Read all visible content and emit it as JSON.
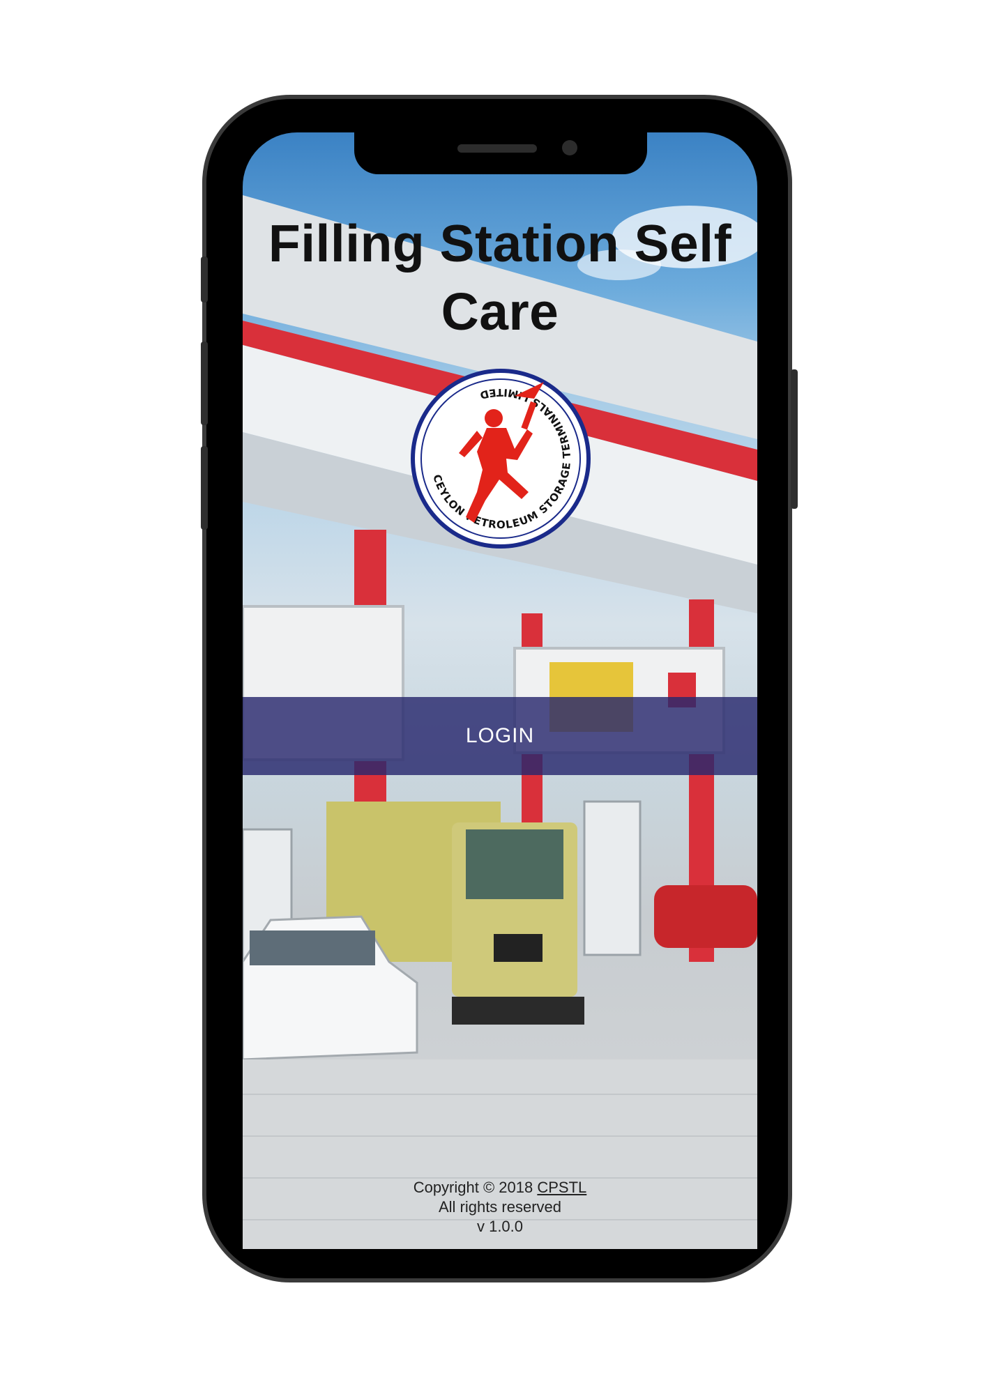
{
  "app": {
    "title": "Filling Station Self Care"
  },
  "logo": {
    "ring_text": "CEYLON PETROLEUM STORAGE TERMINALS LIMITED",
    "colors": {
      "ring": "#1a2a8a",
      "figure": "#e2231a"
    }
  },
  "actions": {
    "login_label": "LOGIN"
  },
  "footer": {
    "copyright": "Copyright © 2018",
    "company_link": "CPSTL",
    "rights": "All rights reserved",
    "version": "v 1.0.0"
  },
  "colors": {
    "login_bar": "#28286e",
    "canopy_red": "#d9303a"
  }
}
